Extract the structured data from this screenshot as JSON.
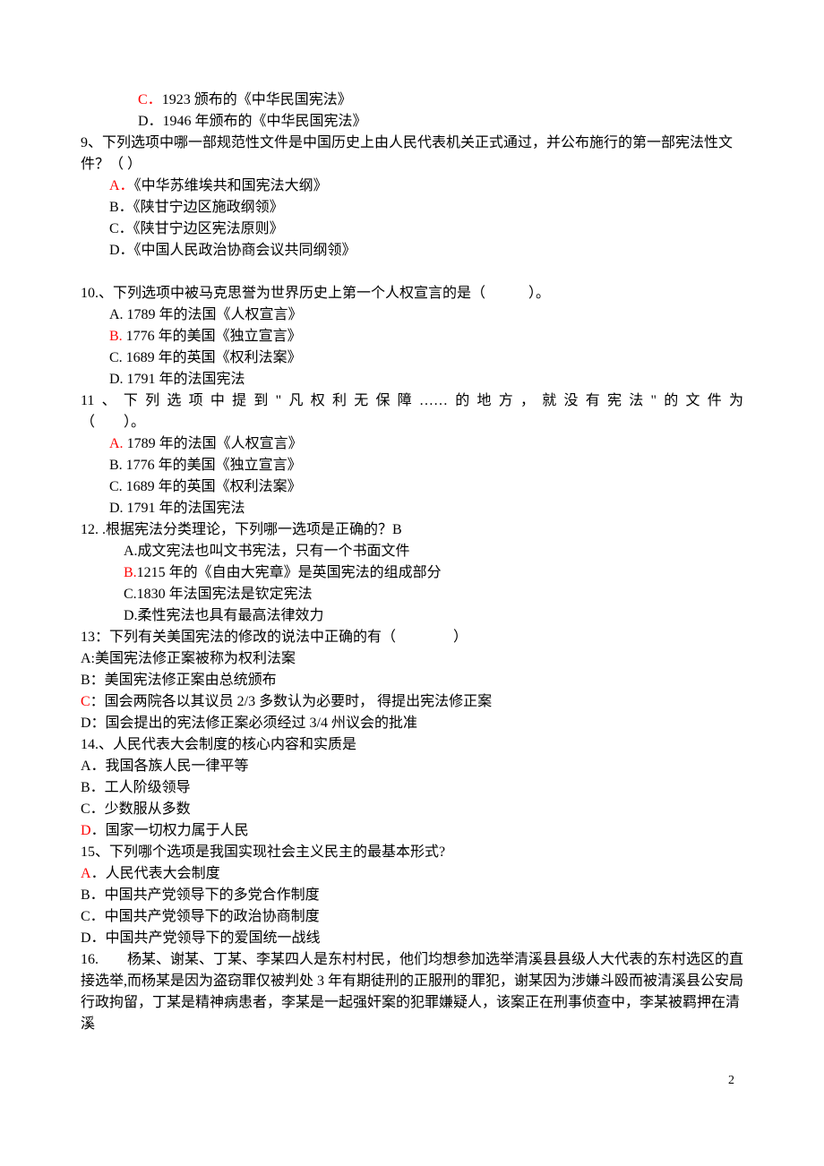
{
  "lines": [
    {
      "cls": "indent-3",
      "segs": [
        {
          "t": "C．",
          "red": true
        },
        {
          "t": "1923 颁布的《中华民国宪法》"
        }
      ]
    },
    {
      "cls": "indent-3",
      "segs": [
        {
          "t": "D．1946 年颁布的《中华民国宪法》"
        }
      ]
    },
    {
      "cls": "",
      "segs": [
        {
          "t": "9、下列选项中哪一部规范性文件是中国历史上由人民代表机关正式通过，并公布施行的第一部宪法性文件？（ ）"
        }
      ]
    },
    {
      "cls": "indent-1",
      "segs": [
        {
          "t": "A．",
          "red": true
        },
        {
          "t": "《中华苏维埃共和国宪法大纲》"
        }
      ]
    },
    {
      "cls": "indent-1",
      "segs": [
        {
          "t": "B．《陕甘宁边区施政纲领》"
        }
      ]
    },
    {
      "cls": "indent-1",
      "segs": [
        {
          "t": "C．《陕甘宁边区宪法原则》"
        }
      ]
    },
    {
      "cls": "indent-1",
      "segs": [
        {
          "t": "D．《中国人民政治协商会议共同纲领》"
        }
      ]
    },
    {
      "cls": "",
      "segs": [
        {
          "t": " "
        }
      ]
    },
    {
      "cls": "",
      "segs": [
        {
          "t": "10.、下列选项中被马克思誉为世界历史上第一个人权宣言的是（　　　）。"
        }
      ]
    },
    {
      "cls": "indent-1",
      "segs": [
        {
          "t": "A. 1789 年的法国《人权宣言》"
        }
      ]
    },
    {
      "cls": "indent-1",
      "segs": [
        {
          "t": "B.",
          "red": true
        },
        {
          "t": " 1776 年的美国《独立宣言》"
        }
      ]
    },
    {
      "cls": "indent-1",
      "segs": [
        {
          "t": "C. 1689 年的英国《权利法案》"
        }
      ]
    },
    {
      "cls": "indent-1",
      "segs": [
        {
          "t": "D. 1791 年的法国宪法"
        }
      ]
    },
    {
      "cls": "justify",
      "segs": [
        {
          "t": "11、下列选项中提到\"凡权利无保障……的地方，就没有宪法\"的文件为"
        }
      ]
    },
    {
      "cls": "",
      "segs": [
        {
          "t": "（　　）。"
        }
      ]
    },
    {
      "cls": "indent-1",
      "segs": [
        {
          "t": "A.",
          "red": true
        },
        {
          "t": " 1789 年的法国《人权宣言》"
        }
      ]
    },
    {
      "cls": "indent-1",
      "segs": [
        {
          "t": "B. 1776 年的美国《独立宣言》"
        }
      ]
    },
    {
      "cls": "indent-1",
      "segs": [
        {
          "t": "C. 1689 年的英国《权利法案》"
        }
      ]
    },
    {
      "cls": "indent-1",
      "segs": [
        {
          "t": "D. 1791 年的法国宪法"
        }
      ]
    },
    {
      "cls": "",
      "segs": [
        {
          "t": "12. .根据宪法分类理论，下列哪一选项是正确的？B"
        }
      ]
    },
    {
      "cls": "indent-2",
      "segs": [
        {
          "t": "A.成文宪法也叫文书宪法，只有一个书面文件"
        }
      ]
    },
    {
      "cls": "indent-2",
      "segs": [
        {
          "t": "B.",
          "red": true
        },
        {
          "t": "1215 年的《自由大宪章》是英国宪法的组成部分"
        }
      ]
    },
    {
      "cls": "indent-2",
      "segs": [
        {
          "t": "C.1830 年法国宪法是钦定宪法"
        }
      ]
    },
    {
      "cls": "indent-2",
      "segs": [
        {
          "t": "D.柔性宪法也具有最高法律效力"
        }
      ]
    },
    {
      "cls": "",
      "segs": [
        {
          "t": "13：下列有关美国宪法的修改的说法中正确的有（　　　　）"
        }
      ]
    },
    {
      "cls": "",
      "segs": [
        {
          "t": "A:美国宪法修正案被称为权利法案"
        }
      ]
    },
    {
      "cls": "",
      "segs": [
        {
          "t": "B：美国宪法修正案由总统颁布"
        }
      ]
    },
    {
      "cls": "",
      "segs": [
        {
          "t": "C",
          "red": true
        },
        {
          "t": "：国会两院各以其议员 2/3 多数认为必要时， 得提出宪法修正案"
        }
      ]
    },
    {
      "cls": "",
      "segs": [
        {
          "t": "D：国会提出的宪法修正案必须经过 3/4 州议会的批准"
        }
      ]
    },
    {
      "cls": "",
      "segs": [
        {
          "t": "14.、人民代表大会制度的核心内容和实质是"
        }
      ]
    },
    {
      "cls": "",
      "segs": [
        {
          "t": "A．我国各族人民一律平等"
        }
      ]
    },
    {
      "cls": "",
      "segs": [
        {
          "t": "B．工人阶级领导"
        }
      ]
    },
    {
      "cls": "",
      "segs": [
        {
          "t": "C．少数服从多数"
        }
      ]
    },
    {
      "cls": "",
      "segs": [
        {
          "t": "D",
          "red": true
        },
        {
          "t": "．国家一切权力属于人民"
        }
      ]
    },
    {
      "cls": "",
      "segs": [
        {
          "t": "15、下列哪个选项是我国实现社会主义民主的最基本形式?"
        }
      ]
    },
    {
      "cls": "",
      "segs": [
        {
          "t": "A",
          "red": true
        },
        {
          "t": "．人民代表大会制度"
        }
      ]
    },
    {
      "cls": "",
      "segs": [
        {
          "t": "B．中国共产党领导下的多党合作制度"
        }
      ]
    },
    {
      "cls": "",
      "segs": [
        {
          "t": "C．中国共产党领导下的政治协商制度"
        }
      ]
    },
    {
      "cls": "",
      "segs": [
        {
          "t": "D．中国共产党领导下的爱国统一战线"
        }
      ]
    },
    {
      "cls": "",
      "segs": [
        {
          "t": "16.　　杨某、谢某、丁某、李某四人是东村村民，他们均想参加选举清溪县县级人大代表的东村选区的直接选举,而杨某是因为盗窃罪仅被判处 3 年有期徒刑的正服刑的罪犯，谢某因为涉嫌斗殴而被清溪县公安局行政拘留，丁某是精神病患者，李某是一起强奸案的犯罪嫌疑人，该案正在刑事侦查中，李某被羁押在清溪"
        }
      ]
    }
  ],
  "page_number": "2"
}
